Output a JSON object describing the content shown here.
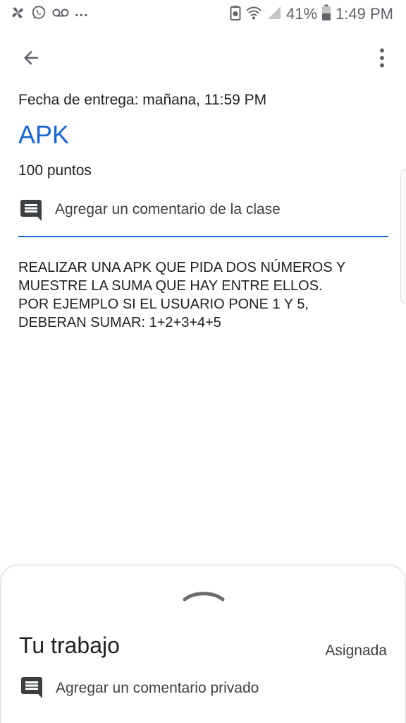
{
  "status_bar": {
    "battery_percent": "41%",
    "time": "1:49 PM",
    "overflow_dots": "...",
    "icons": [
      "pinwheel-icon",
      "whatsapp-icon",
      "voicemail-icon",
      "battery-saver-icon",
      "wifi-icon",
      "signal-icon",
      "battery-icon"
    ]
  },
  "app_bar": {
    "icons": [
      "arrow-back-icon",
      "more-vert-icon"
    ]
  },
  "assignment": {
    "due_date": "Fecha de entrega: mañana, 11:59 PM",
    "title": "APK",
    "points": "100 puntos",
    "class_comment_label": "Agregar un comentario de la clase",
    "description": [
      "REALIZAR UNA APK QUE PIDA DOS NÚMEROS Y",
      "MUESTRE LA SUMA QUE HAY ENTRE ELLOS.",
      "POR EJEMPLO SI EL USUARIO PONE 1 Y 5,",
      "DEBERAN SUMAR: 1+2+3+4+5"
    ]
  },
  "your_work": {
    "title": "Tu trabajo",
    "status": "Asignada",
    "private_comment_label": "Agregar un comentario privado"
  },
  "colors": {
    "accent": "#1967d2",
    "text_primary": "#212121",
    "icon_grey": "#5f6368"
  }
}
